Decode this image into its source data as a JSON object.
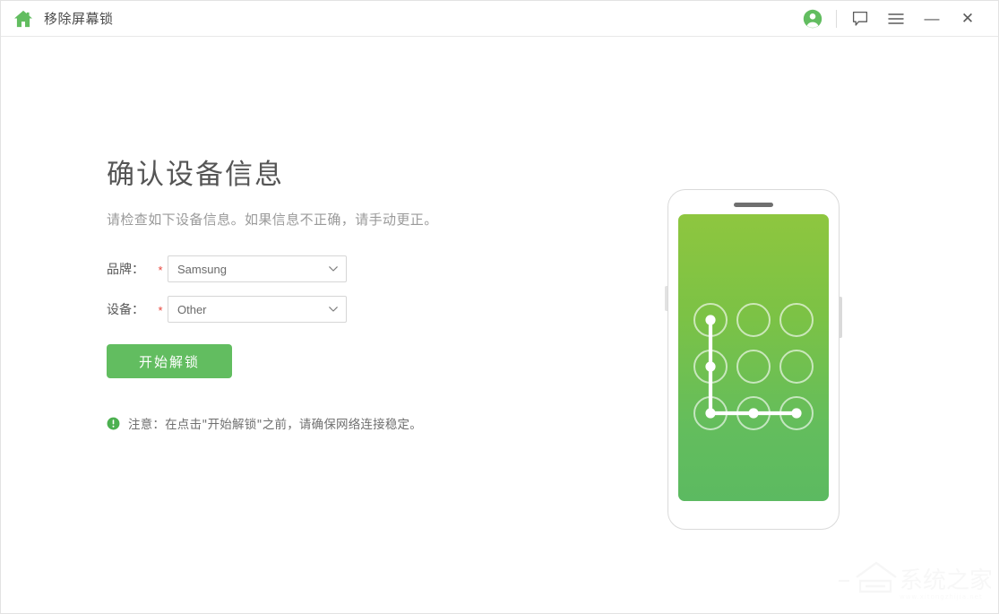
{
  "window": {
    "title": "移除屏幕锁",
    "home_icon": "home-icon"
  },
  "titlebar": {
    "account_icon": "user-account-icon",
    "feedback_icon": "speech-bubble-icon",
    "menu_icon": "hamburger-menu-icon",
    "minimize_icon": "minimize-icon",
    "close_icon": "close-icon",
    "minimize_glyph": "—",
    "close_glyph": "✕"
  },
  "main": {
    "heading": "确认设备信息",
    "subtitle": "请检查如下设备信息。如果信息不正确，请手动更正。",
    "form": {
      "required_mark": "*",
      "fields": [
        {
          "label": "品牌：",
          "name": "brand-select",
          "value": "Samsung",
          "chevron_icon": "chevron-down-icon"
        },
        {
          "label": "设备：",
          "name": "device-select",
          "value": "Other",
          "chevron_icon": "chevron-down-icon"
        }
      ]
    },
    "start_button": "开始解锁",
    "notice": {
      "icon": "exclamation-circle-icon",
      "text": "注意：在点击\"开始解锁\"之前，请确保网络连接稳定。"
    }
  },
  "illustration": {
    "name": "phone-pattern-lock-illustration",
    "screen_gradient_top": "#8ec63f",
    "screen_gradient_bottom": "#5cba61",
    "pattern_points": [
      [
        0,
        0
      ],
      [
        0,
        1
      ],
      [
        0,
        2
      ],
      [
        1,
        2
      ],
      [
        2,
        2
      ]
    ]
  },
  "watermark": {
    "text": "系统之家",
    "subtext": "www.xitongzhijia.net"
  },
  "colors": {
    "accent_green": "#62bd60",
    "required_red": "#e8453c",
    "border_gray": "#d6d6d6",
    "text_dark": "#555555",
    "text_muted": "#9a9a9a"
  }
}
